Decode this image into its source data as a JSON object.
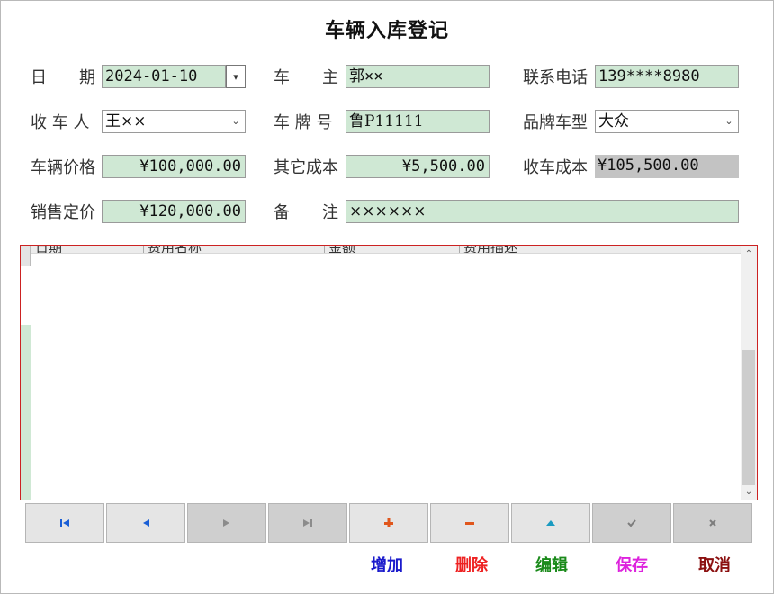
{
  "window": {
    "title": "车辆入库登记"
  },
  "form": {
    "date_label": "日　　期",
    "date_value": "2024-01-10",
    "owner_label": "车　　主",
    "owner_value": "郭××",
    "phone_label": "联系电话",
    "phone_value": "139****8980",
    "receiver_label": "收 车 人",
    "receiver_value": "王××",
    "plate_label": "车 牌 号",
    "plate_value": "鲁P11111",
    "brand_label": "品牌车型",
    "brand_value": "大众",
    "price_label": "车辆价格",
    "price_value": "¥100,000.00",
    "other_cost_label": "其它成本",
    "other_cost_value": "¥5,500.00",
    "total_cost_label": "收车成本",
    "total_cost_value": "¥105,500.00",
    "sale_price_label": "销售定价",
    "sale_price_value": "¥120,000.00",
    "remark_label": "备　　注",
    "remark_value": "××××××"
  },
  "grid": {
    "columns": [
      "日期",
      "费用名称",
      "金额",
      "费用描述"
    ]
  },
  "navigator": {
    "first_icon": "first-record-icon",
    "prev_icon": "prev-record-icon",
    "next_icon": "next-record-icon",
    "last_icon": "last-record-icon",
    "insert_icon": "plus-icon",
    "delete_icon": "minus-icon",
    "edit_icon": "up-arrow-icon",
    "post_icon": "check-icon",
    "cancel_icon": "x-icon"
  },
  "actions": {
    "add": "增加",
    "delete": "删除",
    "edit": "编辑",
    "save": "保存",
    "cancel": "取消"
  },
  "colors": {
    "field_bg": "#cfe8d4",
    "grid_border": "#cc2222",
    "add": "#1a1acc",
    "delete": "#ee2222",
    "edit": "#1a8a1a",
    "save": "#dd22dd",
    "cancel": "#8b1010"
  }
}
